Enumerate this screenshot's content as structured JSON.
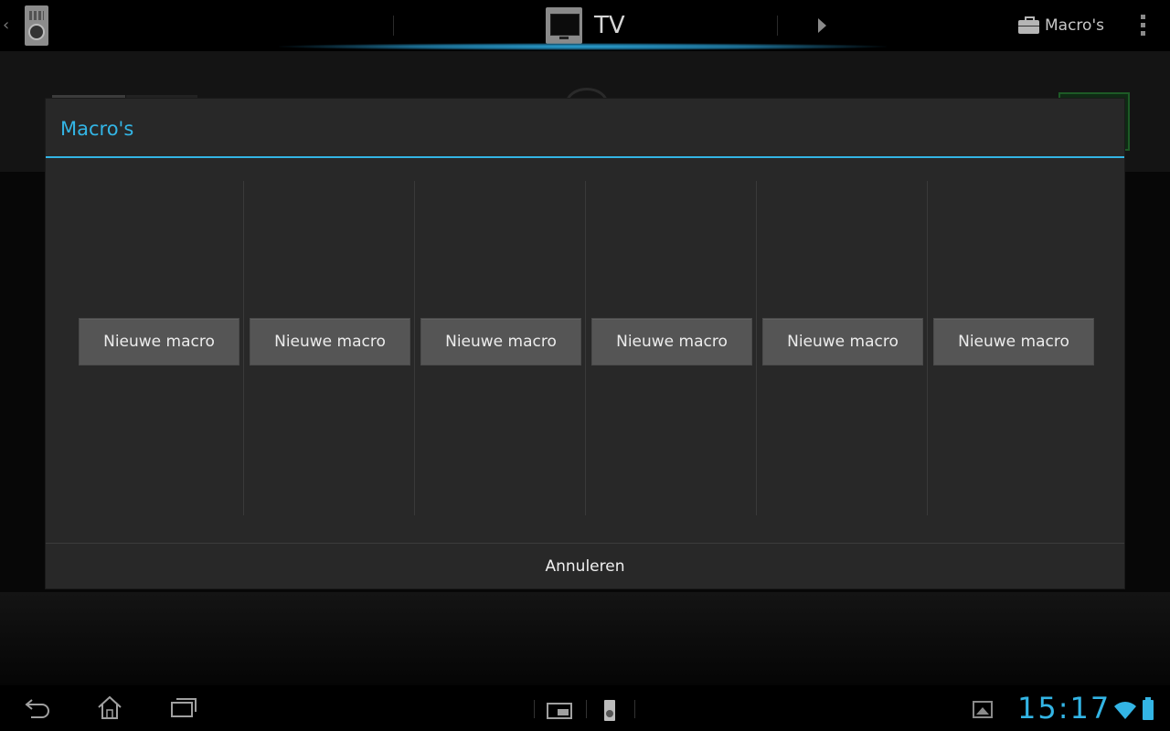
{
  "actionbar": {
    "title": "TV",
    "macros_label": "Macro's",
    "icons": {
      "back": "chevron-left-icon",
      "app": "remote-app-icon",
      "tv": "tv-icon",
      "forward": "play-arrow-icon",
      "toolbox": "toolbox-icon",
      "overflow": "overflow-menu-icon"
    }
  },
  "dialog": {
    "title": "Macro's",
    "slots": [
      {
        "label": "Nieuwe macro"
      },
      {
        "label": "Nieuwe macro"
      },
      {
        "label": "Nieuwe macro"
      },
      {
        "label": "Nieuwe macro"
      },
      {
        "label": "Nieuwe macro"
      },
      {
        "label": "Nieuwe macro"
      }
    ],
    "cancel_label": "Annuleren"
  },
  "systembar": {
    "time": "15:17",
    "icons": [
      "back-icon",
      "home-icon",
      "recent-apps-icon",
      "screenshot-icon",
      "remote-notification-icon",
      "gallery-icon",
      "wifi-icon",
      "battery-icon"
    ]
  },
  "colors": {
    "accent": "#33b5e5",
    "dialog_bg": "#282828",
    "button_bg": "#555555"
  }
}
